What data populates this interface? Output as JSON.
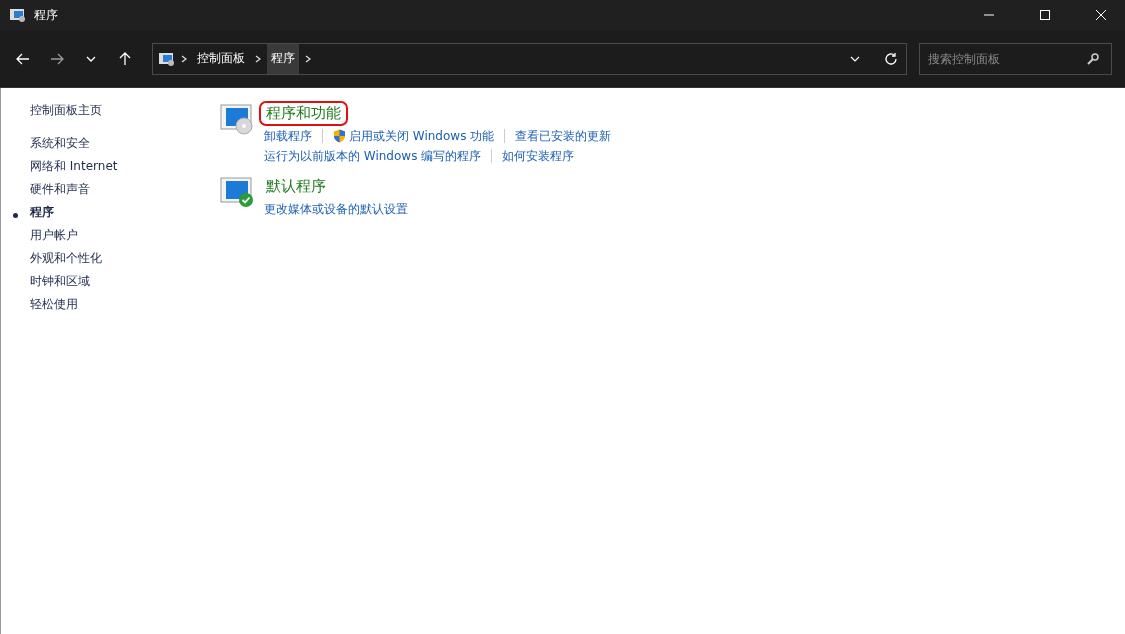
{
  "window": {
    "title": "程序"
  },
  "breadcrumb": [
    {
      "label": "控制面板",
      "selected": false
    },
    {
      "label": "程序",
      "selected": true
    }
  ],
  "search": {
    "placeholder": "搜索控制面板"
  },
  "sidebar": {
    "home": "控制面板主页",
    "items": [
      {
        "label": "系统和安全",
        "selected": false
      },
      {
        "label": "网络和 Internet",
        "selected": false
      },
      {
        "label": "硬件和声音",
        "selected": false
      },
      {
        "label": "程序",
        "selected": true
      },
      {
        "label": "用户帐户",
        "selected": false
      },
      {
        "label": "外观和个性化",
        "selected": false
      },
      {
        "label": "时钟和区域",
        "selected": false
      },
      {
        "label": "轻松使用",
        "selected": false
      }
    ]
  },
  "sections": [
    {
      "title": "程序和功能",
      "kind": "programs",
      "highlighted": true,
      "link_rows": [
        [
          {
            "label": "卸载程序",
            "kind": "plain"
          },
          {
            "label": "启用或关闭 Windows 功能",
            "kind": "shield"
          },
          {
            "label": "查看已安装的更新",
            "kind": "plain"
          }
        ],
        [
          {
            "label": "运行为以前版本的 Windows 编写的程序",
            "kind": "plain"
          },
          {
            "label": "如何安装程序",
            "kind": "plain"
          }
        ]
      ]
    },
    {
      "title": "默认程序",
      "kind": "defaults",
      "highlighted": false,
      "link_rows": [
        [
          {
            "label": "更改媒体或设备的默认设置",
            "kind": "plain"
          }
        ]
      ]
    }
  ]
}
